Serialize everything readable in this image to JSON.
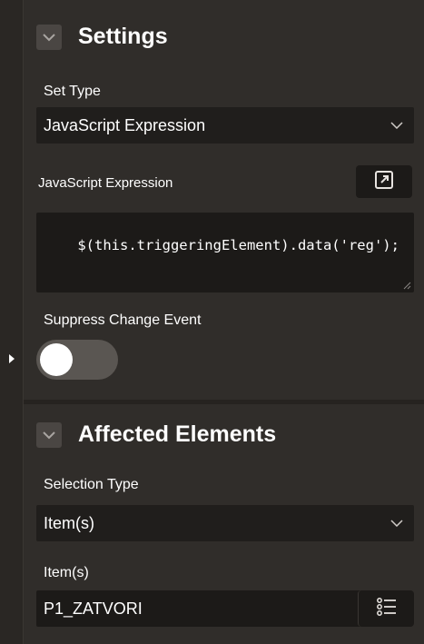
{
  "settings": {
    "title": "Settings",
    "set_type_label": "Set Type",
    "set_type_value": "JavaScript Expression",
    "js_expression_label": "JavaScript Expression",
    "js_expression_value": "$(this.triggeringElement).data('reg');",
    "suppress_change_label": "Suppress Change Event",
    "suppress_change_on": false
  },
  "affected": {
    "title": "Affected Elements",
    "selection_type_label": "Selection Type",
    "selection_type_value": "Item(s)",
    "items_label": "Item(s)",
    "items_value": "P1_ZATVORI"
  },
  "icons": {
    "collapse_settings": "chevron-down-icon",
    "collapse_affected": "chevron-down-icon",
    "select_dropdown": "chevron-down-icon",
    "expand_editor": "expand-icon",
    "list_picker": "list-icon",
    "rail_toggle": "caret-right-icon"
  },
  "colors": {
    "background": "#302d2a",
    "field_bg": "#1c1a18",
    "toggle_off": "#5a5652",
    "text": "#ffffff"
  }
}
